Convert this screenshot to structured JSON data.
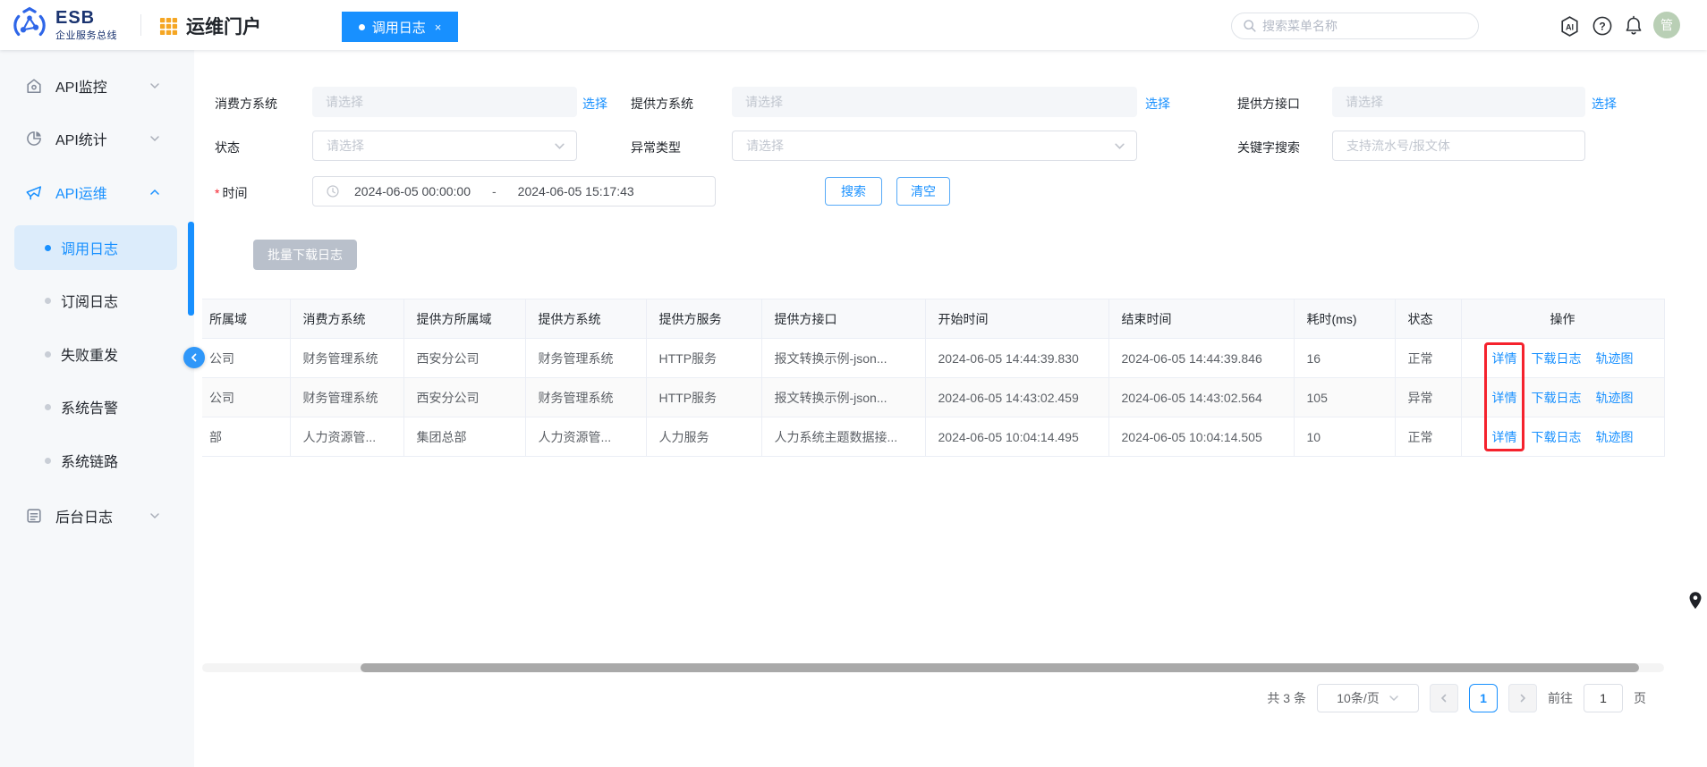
{
  "colors": {
    "primary": "#1890ff",
    "highlight_red": "#f5222d",
    "tab_bg": "#1890ff",
    "disabled_button_bg": "#b9c0cb",
    "avatar_bg": "#b9cfb5",
    "active_item_bg": "#dcecfb",
    "portal_icon_orange": "#f5a623"
  },
  "header": {
    "brand_title": "ESB",
    "brand_subtitle": "企业服务总线",
    "portal_title": "运维门户",
    "tab": {
      "label": "调用日志",
      "close": "×"
    },
    "search_placeholder": "搜索菜单名称",
    "ai_badge": "AI",
    "help_mark": "?",
    "avatar_text": "管"
  },
  "sidebar": {
    "groups": [
      {
        "label": "API监控"
      },
      {
        "label": "API统计"
      },
      {
        "label": "API运维",
        "children": [
          "调用日志",
          "订阅日志",
          "失败重发",
          "系统告警",
          "系统链路"
        ]
      },
      {
        "label": "后台日志"
      }
    ]
  },
  "filters": {
    "consumer_system": {
      "label": "消费方系统",
      "placeholder": "请选择",
      "action": "选择"
    },
    "provider_system": {
      "label": "提供方系统",
      "placeholder": "请选择",
      "action": "选择"
    },
    "provider_api": {
      "label": "提供方接口",
      "placeholder": "请选择",
      "action": "选择"
    },
    "status": {
      "label": "状态",
      "placeholder": "请选择"
    },
    "exception_type": {
      "label": "异常类型",
      "placeholder": "请选择"
    },
    "keyword": {
      "label": "关键字搜索",
      "placeholder": "支持流水号/报文体"
    },
    "time": {
      "label": "时间",
      "required_mark": "*",
      "start": "2024-06-05 00:00:00",
      "separator": "-",
      "end": "2024-06-05 15:17:43"
    },
    "search_button": "搜索",
    "clear_button": "清空"
  },
  "toolbar": {
    "batch_download": "批量下载日志"
  },
  "table": {
    "columns": [
      "所属域",
      "消费方系统",
      "提供方所属域",
      "提供方系统",
      "提供方服务",
      "提供方接口",
      "开始时间",
      "结束时间",
      "耗时(ms)",
      "状态",
      "操作"
    ],
    "rows": [
      {
        "cells": [
          "公司",
          "财务管理系统",
          "西安分公司",
          "财务管理系统",
          "HTTP服务",
          "报文转换示例-json...",
          "2024-06-05 14:44:39.830",
          "2024-06-05 14:44:39.846",
          "16",
          "正常"
        ],
        "actions": [
          "详情",
          "下载日志",
          "轨迹图"
        ]
      },
      {
        "cells": [
          "公司",
          "财务管理系统",
          "西安分公司",
          "财务管理系统",
          "HTTP服务",
          "报文转换示例-json...",
          "2024-06-05 14:43:02.459",
          "2024-06-05 14:43:02.564",
          "105",
          "异常"
        ],
        "actions": [
          "详情",
          "下载日志",
          "轨迹图"
        ]
      },
      {
        "cells": [
          "部",
          "人力资源管...",
          "集团总部",
          "人力资源管...",
          "人力服务",
          "人力系统主题数据接...",
          "2024-06-05 10:04:14.495",
          "2024-06-05 10:04:14.505",
          "10",
          "正常"
        ],
        "actions": [
          "详情",
          "下载日志",
          "轨迹图"
        ]
      }
    ]
  },
  "pagination": {
    "total": "共 3 条",
    "page_size": "10条/页",
    "current_page": "1",
    "goto_label": "前往",
    "goto_value": "1",
    "unit_label": "页"
  }
}
